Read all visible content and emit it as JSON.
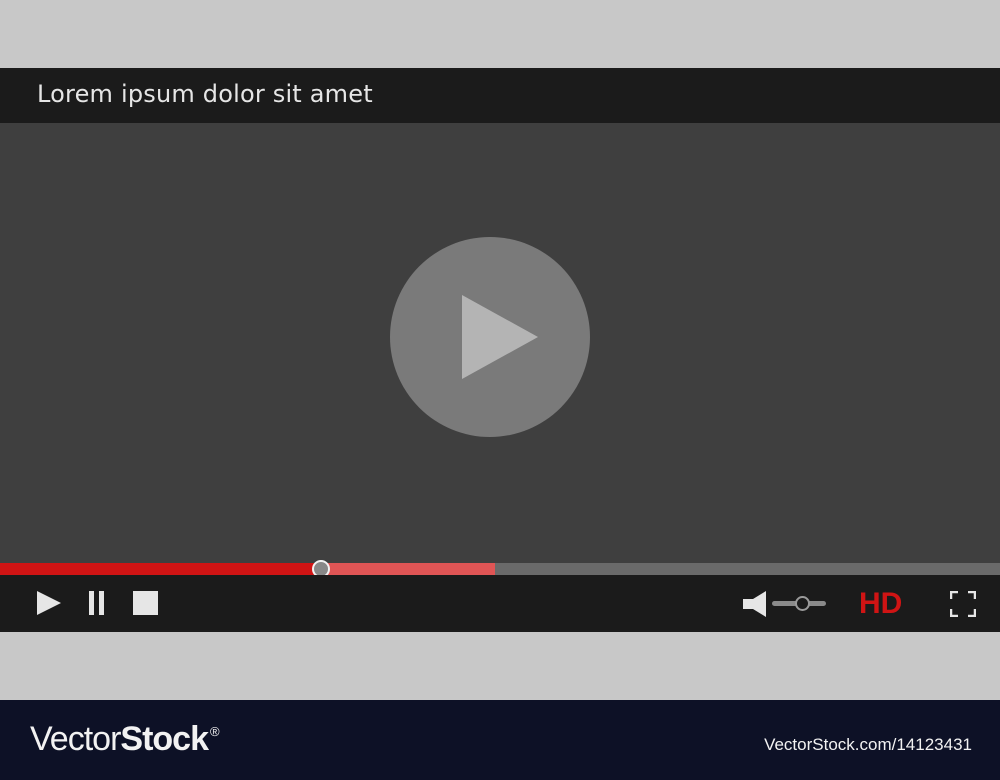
{
  "player": {
    "title": "Lorem ipsum dolor sit amet",
    "progress": {
      "played_fraction": 0.321,
      "buffered_fraction": 0.495
    },
    "volume_fraction": 0.55,
    "quality_label": "HD"
  },
  "footer": {
    "logo_regular": "Vector",
    "logo_bold": "Stock",
    "logo_mark": "®",
    "image_id": "VectorStock.com/14123431"
  },
  "colors": {
    "accent": "#d01414",
    "buffered": "#e05555",
    "bar": "#1b1b1b",
    "video_bg": "#3f3f3f"
  },
  "icons": {
    "big_play": "play-icon",
    "play": "play-icon",
    "pause": "pause-icon",
    "stop": "stop-icon",
    "volume": "speaker-icon",
    "fullscreen": "fullscreen-icon"
  }
}
